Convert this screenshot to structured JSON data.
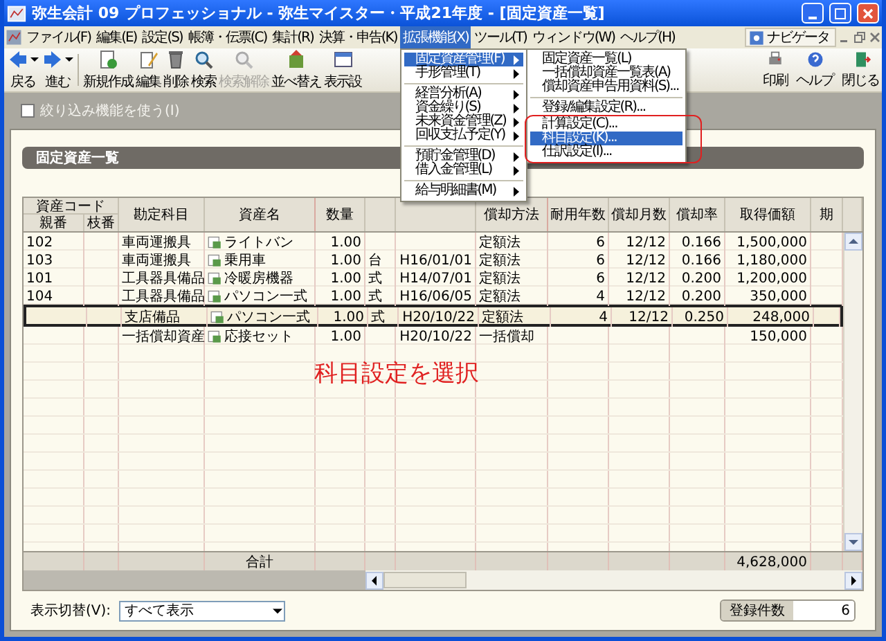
{
  "window": {
    "title": "弥生会計 09 プロフェッショナル - 弥生マイスター・平成21年度 - [固定資産一覧]"
  },
  "menu_bar": {
    "items": [
      {
        "label": "ファイル(F)",
        "selected": false
      },
      {
        "label": "編集(E)",
        "selected": false
      },
      {
        "label": "設定(S)",
        "selected": false
      },
      {
        "label": "帳簿・伝票(C)",
        "selected": false
      },
      {
        "label": "集計(R)",
        "selected": false
      },
      {
        "label": "決算・申告(K)",
        "selected": false
      },
      {
        "label": "拡張機能(X)",
        "selected": true
      },
      {
        "label": "ツール(T)",
        "selected": false
      },
      {
        "label": "ウィンドウ(W)",
        "selected": false
      },
      {
        "label": "ヘルプ(H)",
        "selected": false
      }
    ],
    "navigator": "ナビゲータ"
  },
  "expanded_menu": {
    "items": [
      {
        "kind": "item",
        "label": "固定資産管理(F)",
        "selected": true,
        "has_submenu": true
      },
      {
        "kind": "item",
        "label": "手形管理(T)",
        "selected": false,
        "has_submenu": true
      },
      {
        "kind": "separator"
      },
      {
        "kind": "item",
        "label": "経営分析(A)",
        "selected": false,
        "has_submenu": true
      },
      {
        "kind": "item",
        "label": "資金繰り(S)",
        "selected": false,
        "has_submenu": true
      },
      {
        "kind": "item",
        "label": "未来資金管理(Z)",
        "selected": false,
        "has_submenu": true
      },
      {
        "kind": "item",
        "label": "回収支払予定(Y)",
        "selected": false,
        "has_submenu": true
      },
      {
        "kind": "separator"
      },
      {
        "kind": "item",
        "label": "預貯金管理(D)",
        "selected": false,
        "has_submenu": true
      },
      {
        "kind": "item",
        "label": "借入金管理(L)",
        "selected": false,
        "has_submenu": true
      },
      {
        "kind": "separator"
      },
      {
        "kind": "item",
        "label": "給与明細書(M)",
        "selected": false,
        "has_submenu": true
      }
    ]
  },
  "submenu": {
    "items": [
      {
        "kind": "item",
        "label": "固定資産一覧(L)",
        "selected": false,
        "outlined": false
      },
      {
        "kind": "item",
        "label": "一括償却資産一覧表(A)",
        "selected": false,
        "outlined": false
      },
      {
        "kind": "item",
        "label": "償却資産申告用資料(S)...",
        "selected": false,
        "outlined": false
      },
      {
        "kind": "separator"
      },
      {
        "kind": "item",
        "label": "登録/編集設定(R)...",
        "selected": false,
        "outlined": false
      },
      {
        "kind": "item",
        "label": "計算設定(C)...",
        "selected": false,
        "outlined": true
      },
      {
        "kind": "item",
        "label": "科目設定(K)...",
        "selected": true,
        "outlined": true
      },
      {
        "kind": "item",
        "label": "仕訳設定(I)...",
        "selected": false,
        "outlined": true
      }
    ]
  },
  "toolbar": {
    "buttons": [
      {
        "label": "戻る",
        "disabled": false,
        "dropdown": true
      },
      {
        "label": "進む",
        "disabled": false,
        "dropdown": true
      },
      {
        "label": "新規作成",
        "disabled": false,
        "dropdown": false
      },
      {
        "label": "編集",
        "disabled": false,
        "dropdown": false
      },
      {
        "label": "削除",
        "disabled": false,
        "dropdown": false
      },
      {
        "label": "検索",
        "disabled": false,
        "dropdown": false
      },
      {
        "label": "検索解除",
        "disabled": true,
        "dropdown": false
      },
      {
        "label": "並べ替え",
        "disabled": false,
        "dropdown": false
      },
      {
        "label": "表示設",
        "disabled": false,
        "dropdown": false
      }
    ],
    "right_buttons": [
      {
        "label": "印刷"
      },
      {
        "label": "ヘルプ"
      },
      {
        "label": "閉じる"
      }
    ]
  },
  "filter": {
    "label": "絞り込み機能を使う(I)",
    "checked": false,
    "disabled": true
  },
  "panel": {
    "title": "固定資産一覧"
  },
  "table": {
    "column_group": "資産コード",
    "columns": [
      "親番",
      "枝番",
      "勘定科目",
      "資産名",
      "数量",
      null,
      null,
      "償却方法",
      "耐用年数",
      "償却月数",
      "償却率",
      "取得価額",
      "期"
    ],
    "rows": [
      {
        "selected": false,
        "cells": [
          "102",
          null,
          "車両運搬具",
          "ライトバン",
          "1.00",
          null,
          null,
          "定額法",
          "6",
          "12/12",
          "0.166",
          "1,500,000",
          null
        ]
      },
      {
        "selected": false,
        "cells": [
          "103",
          null,
          "車両運搬具",
          "乗用車",
          "1.00",
          "台",
          "H16/01/01",
          "定額法",
          "6",
          "12/12",
          "0.166",
          "1,180,000",
          null
        ]
      },
      {
        "selected": false,
        "cells": [
          "101",
          null,
          "工具器具備品",
          "冷暖房機器",
          "1.00",
          "式",
          "H14/07/01",
          "定額法",
          "6",
          "12/12",
          "0.200",
          "1,200,000",
          null
        ]
      },
      {
        "selected": false,
        "cells": [
          "104",
          null,
          "工具器具備品",
          "パソコン一式",
          "1.00",
          "式",
          "H16/06/05",
          "定額法",
          "4",
          "12/12",
          "0.200",
          "350,000",
          null
        ]
      },
      {
        "selected": true,
        "cells": [
          null,
          null,
          "支店備品",
          "パソコン一式",
          "1.00",
          "式",
          "H20/10/22",
          "定額法",
          "4",
          "12/12",
          "0.250",
          "248,000",
          null
        ]
      },
      {
        "selected": false,
        "cells": [
          null,
          null,
          "一括償却資産",
          "応接セット",
          "1.00",
          null,
          "H20/10/22",
          "一括償却",
          null,
          null,
          null,
          "150,000",
          null
        ]
      }
    ],
    "totals": {
      "label": "合計",
      "acquisition_cost": "4,628,000"
    }
  },
  "annotation": "科目設定を選択",
  "display_switch": {
    "label": "表示切替(V):",
    "value": "すべて表示"
  },
  "record_count": {
    "label": "登録件数",
    "value": "6"
  }
}
